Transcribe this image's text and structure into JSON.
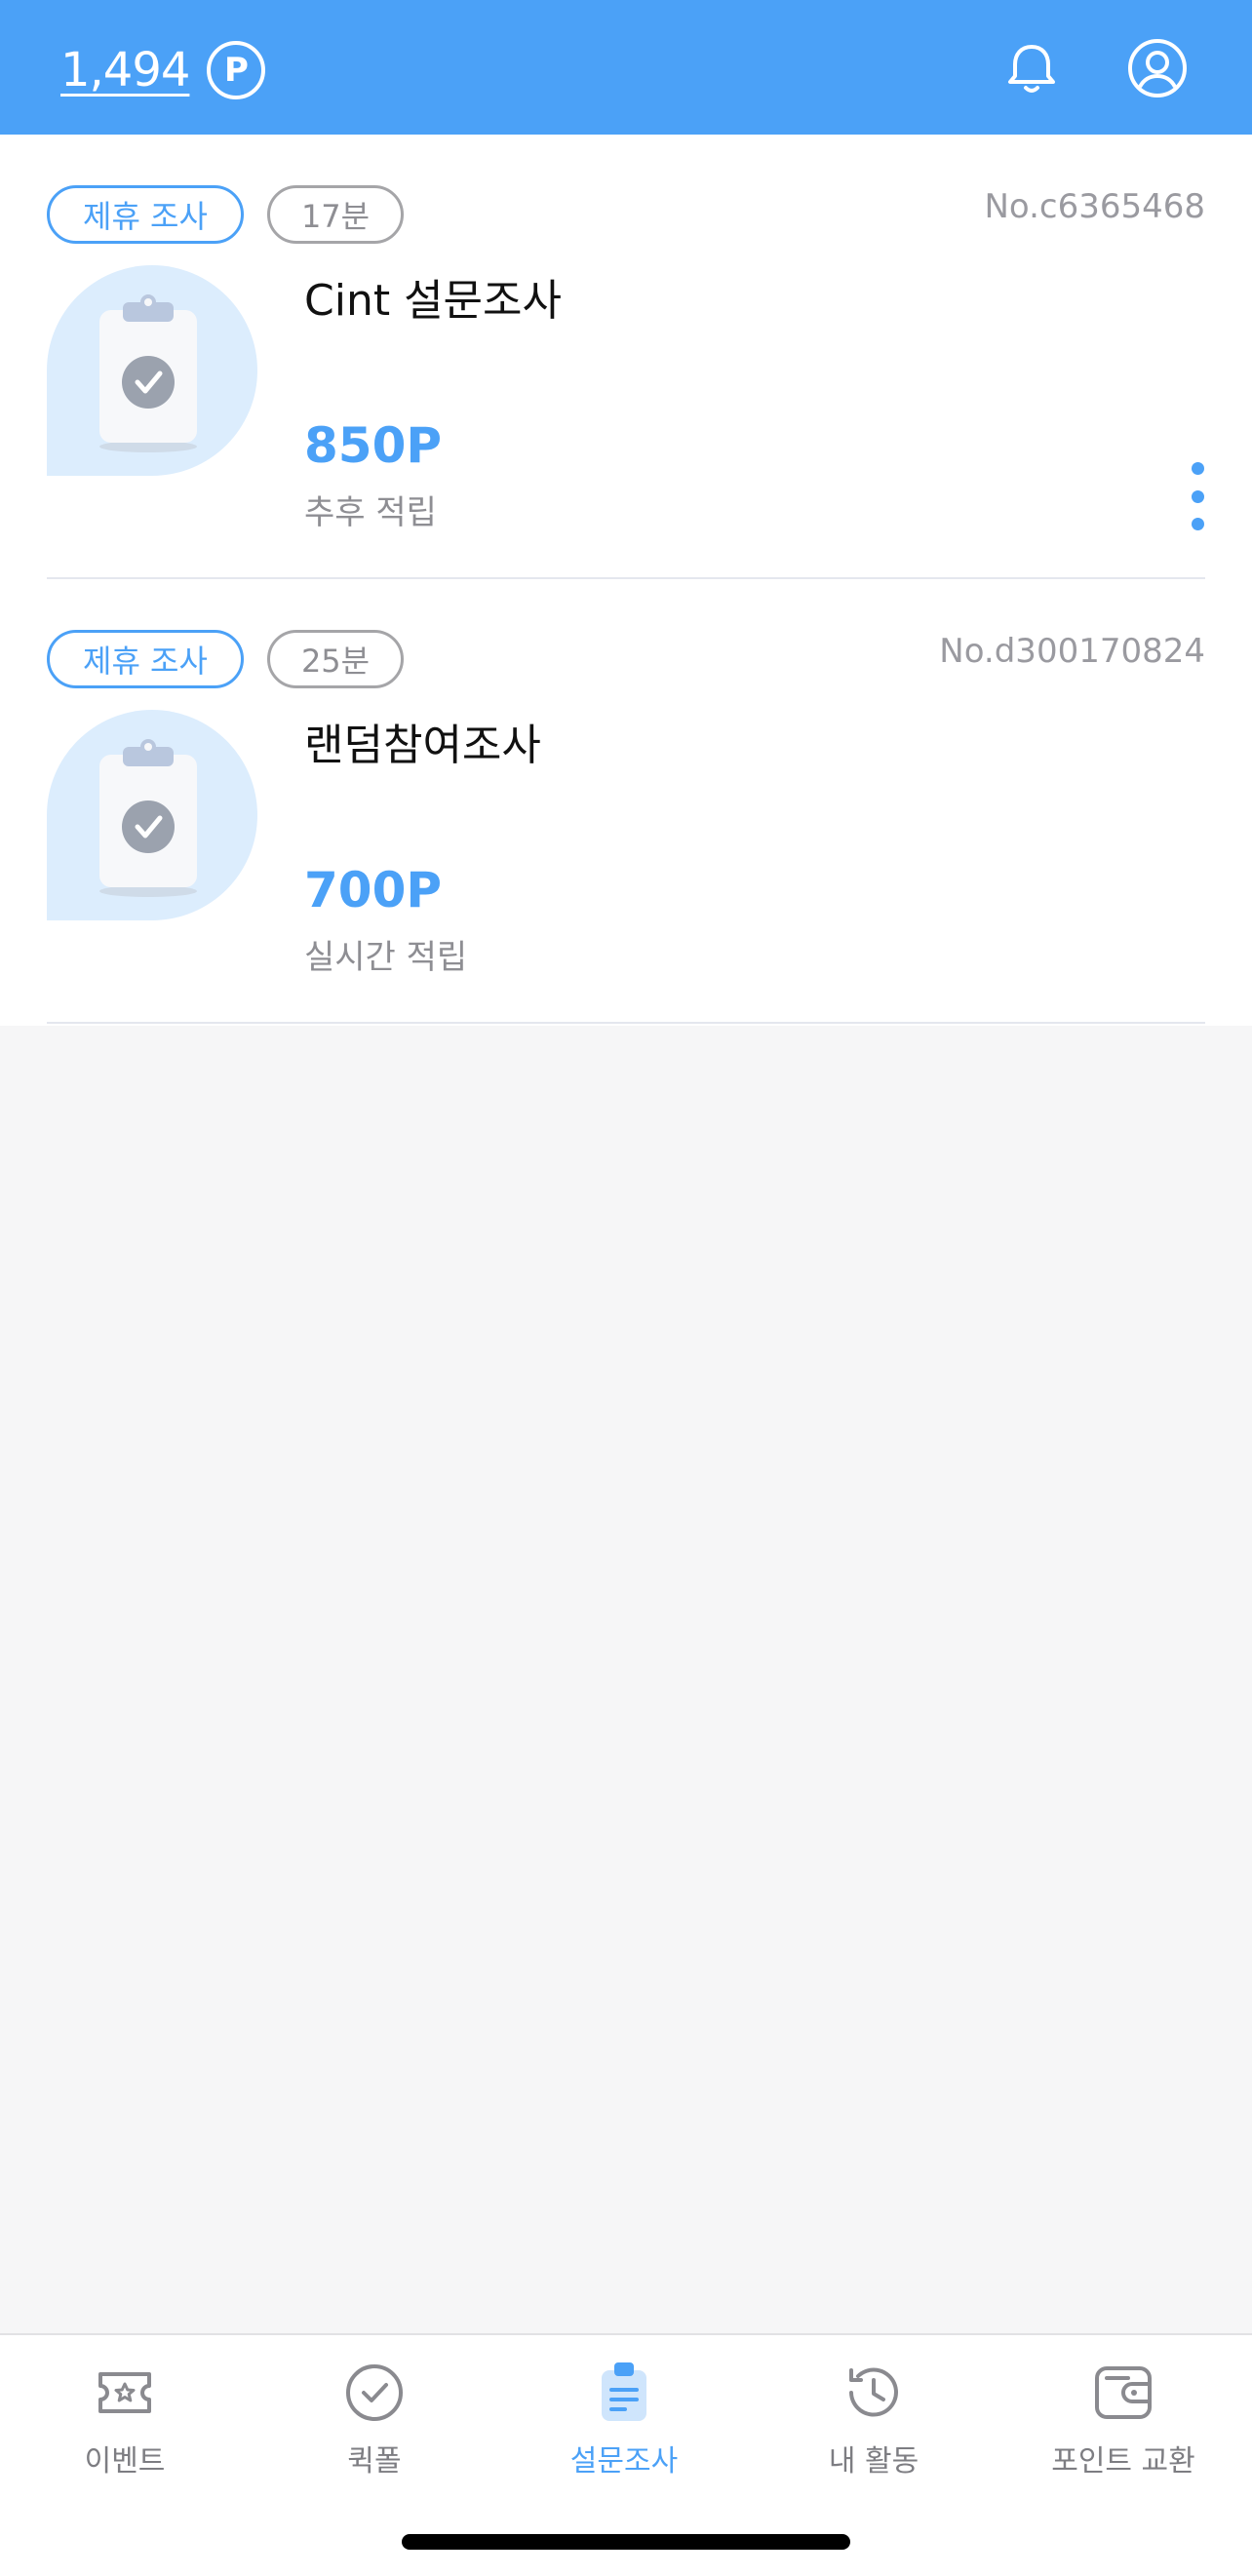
{
  "header": {
    "points_value": "1,494",
    "points_badge": "P",
    "bell_icon": "bell-icon",
    "profile_icon": "profile-icon"
  },
  "surveys": [
    {
      "tag_type": "제휴 조사",
      "tag_time": "17분",
      "survey_no": "No.c6365468",
      "title": "Cint 설문조사",
      "reward": "850P",
      "reward_note": "추후 적립",
      "icon": "clipboard-check-icon"
    },
    {
      "tag_type": "제휴 조사",
      "tag_time": "25분",
      "survey_no": "No.d300170824",
      "title": "랜덤참여조사",
      "reward": "700P",
      "reward_note": "실시간 적립",
      "icon": "clipboard-check-icon"
    }
  ],
  "nav": {
    "items": [
      {
        "label": "이벤트",
        "icon": "ticket-icon"
      },
      {
        "label": "퀵폴",
        "icon": "check-circle-icon"
      },
      {
        "label": "설문조사",
        "icon": "clipboard-icon"
      },
      {
        "label": "내 활동",
        "icon": "history-icon"
      },
      {
        "label": "포인트 교환",
        "icon": "wallet-icon"
      }
    ],
    "active_index": 2
  },
  "colors": {
    "accent": "#4ba1f7",
    "background": "#f6f6f7",
    "muted_text": "#8e8e93"
  }
}
